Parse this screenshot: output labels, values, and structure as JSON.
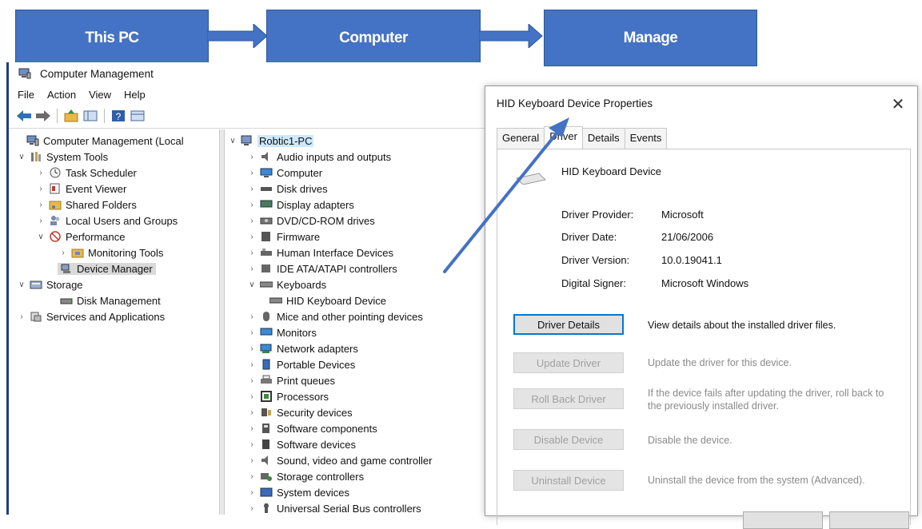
{
  "flow": {
    "step1": "This PC",
    "step2": "Computer",
    "step3": "Manage",
    "color": "#4472c4"
  },
  "cm": {
    "title": "Computer Management",
    "menu": [
      "File",
      "Action",
      "View",
      "Help"
    ],
    "left_tree": [
      {
        "label": "Computer Management (Local",
        "icon": "computer-management-icon"
      },
      {
        "label": "System Tools",
        "icon": "tools-icon"
      },
      {
        "label": "Task Scheduler",
        "icon": "clock-icon"
      },
      {
        "label": "Event Viewer",
        "icon": "event-viewer-icon"
      },
      {
        "label": "Shared Folders",
        "icon": "shared-folder-icon"
      },
      {
        "label": "Local Users and Groups",
        "icon": "users-icon"
      },
      {
        "label": "Performance",
        "icon": "performance-icon"
      },
      {
        "label": "Monitoring Tools",
        "icon": "monitor-folder-icon"
      },
      {
        "label": "Device Manager",
        "icon": "device-manager-icon"
      },
      {
        "label": "Storage",
        "icon": "storage-icon"
      },
      {
        "label": "Disk Management",
        "icon": "disk-icon"
      },
      {
        "label": "Services and Applications",
        "icon": "services-icon"
      }
    ],
    "device_tree": {
      "root": "Robtic1-PC",
      "items": [
        "Audio inputs and outputs",
        "Computer",
        "Disk drives",
        "Display adapters",
        "DVD/CD-ROM drives",
        "Firmware",
        "Human Interface Devices",
        "IDE ATA/ATAPI controllers",
        "Keyboards",
        "HID Keyboard Device",
        "Mice and other pointing devices",
        "Monitors",
        "Network adapters",
        "Portable Devices",
        "Print queues",
        "Processors",
        "Security devices",
        "Software components",
        "Software devices",
        "Sound, video and game controller",
        "Storage controllers",
        "System devices",
        "Universal Serial Bus controllers"
      ]
    }
  },
  "dialog": {
    "title": "HID Keyboard Device Properties",
    "tabs": [
      "General",
      "Driver",
      "Details",
      "Events"
    ],
    "active_tab": "Driver",
    "device_name": "HID Keyboard Device",
    "info": [
      {
        "label": "Driver Provider:",
        "value": "Microsoft"
      },
      {
        "label": "Driver Date:",
        "value": "21/06/2006"
      },
      {
        "label": "Driver Version:",
        "value": "10.0.19041.1"
      },
      {
        "label": "Digital Signer:",
        "value": "Microsoft Windows"
      }
    ],
    "buttons": [
      {
        "label": "Driver Details",
        "desc": "View details about the installed driver files.",
        "enabled": true
      },
      {
        "label": "Update Driver",
        "desc": "Update the driver for this device.",
        "enabled": false
      },
      {
        "label": "Roll Back Driver",
        "desc": "If the device fails after updating the driver, roll back to the previously installed driver.",
        "enabled": false
      },
      {
        "label": "Disable Device",
        "desc": "Disable the device.",
        "enabled": false
      },
      {
        "label": "Uninstall Device",
        "desc": "Uninstall the device from the system (Advanced).",
        "enabled": false
      }
    ]
  }
}
